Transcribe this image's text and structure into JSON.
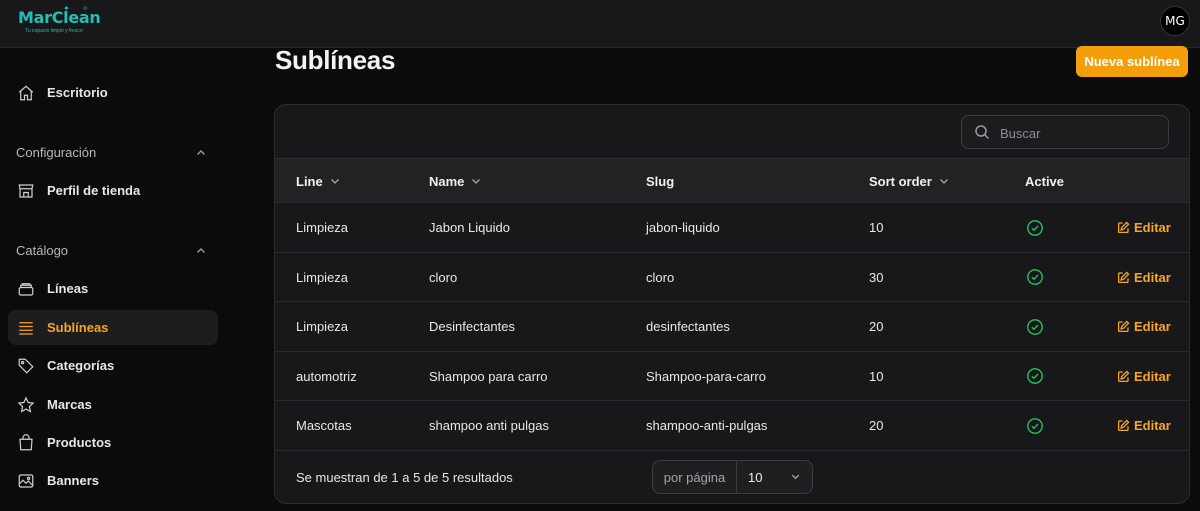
{
  "app": {
    "logo_text": "MarClean",
    "logo_tagline": "Tu espacio limpio y fresco",
    "user_initials": "MG"
  },
  "sidebar": {
    "escritorio": {
      "label": "Escritorio",
      "icon": "home-icon"
    },
    "groups": [
      {
        "label": "Configuración",
        "items": [
          {
            "label": "Perfil de tienda",
            "icon": "store-icon"
          }
        ]
      },
      {
        "label": "Catálogo",
        "items": [
          {
            "label": "Líneas",
            "icon": "layers-icon"
          },
          {
            "label": "Sublíneas",
            "icon": "list-icon",
            "active": true
          },
          {
            "label": "Categorías",
            "icon": "tag-icon"
          },
          {
            "label": "Marcas",
            "icon": "star-icon"
          },
          {
            "label": "Productos",
            "icon": "shopping-bag-icon"
          },
          {
            "label": "Banners",
            "icon": "image-icon"
          }
        ]
      }
    ]
  },
  "page": {
    "title": "Sublíneas",
    "new_button": "Nueva sublínea"
  },
  "table": {
    "search_placeholder": "Buscar",
    "columns": [
      "Line",
      "Name",
      "Slug",
      "Sort order",
      "Active"
    ],
    "edit_label": "Editar",
    "rows": [
      {
        "line": "Limpieza",
        "name": "Jabon Liquido",
        "slug": "jabon-liquido",
        "sort": "10",
        "active": true
      },
      {
        "line": "Limpieza",
        "name": "cloro",
        "slug": "cloro",
        "sort": "30",
        "active": true
      },
      {
        "line": "Limpieza",
        "name": "Desinfectantes",
        "slug": "desinfectantes",
        "sort": "20",
        "active": true
      },
      {
        "line": "automotriz",
        "name": "Shampoo para carro",
        "slug": "Shampoo-para-carro",
        "sort": "10",
        "active": true
      },
      {
        "line": "Mascotas",
        "name": "shampoo anti pulgas",
        "slug": "shampoo-anti-pulgas",
        "sort": "20",
        "active": true
      }
    ],
    "results_text": "Se muestran de 1 a 5 de 5 resultados",
    "per_page_label": "por página",
    "per_page_value": "10"
  },
  "colors": {
    "accent": "#f59e0b",
    "brand": "#1fbfb3",
    "active_check": "#22c55e"
  }
}
